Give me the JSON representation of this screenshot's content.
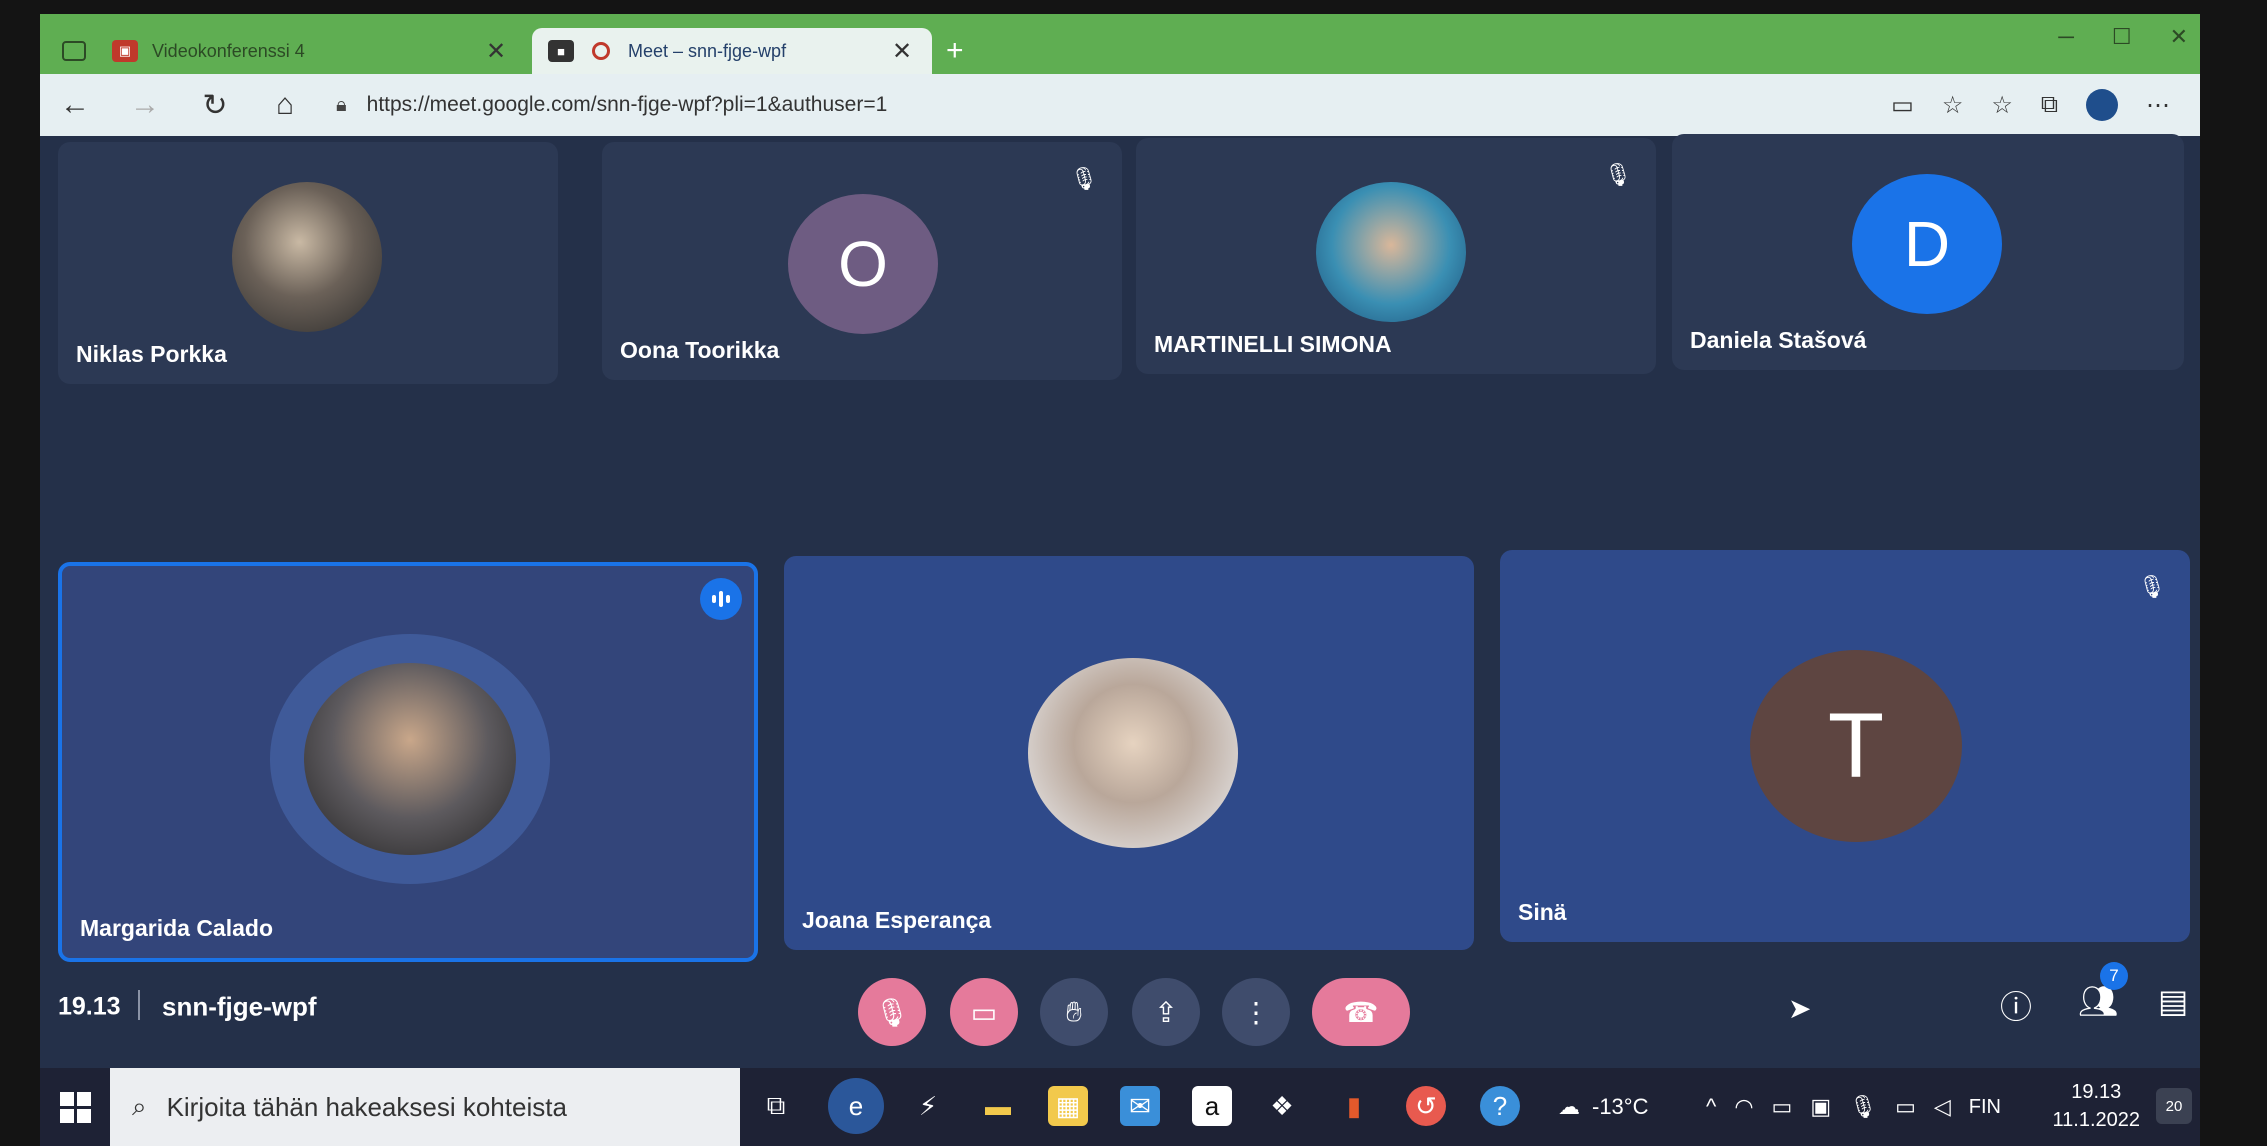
{
  "browser": {
    "tabs": [
      {
        "label": "Videokonferenssi 4",
        "icon": "classroom-icon",
        "active": false
      },
      {
        "label": "Meet – snn-fjge-wpf",
        "icon": "meet-icon",
        "active": true
      }
    ],
    "url": "https://meet.google.com/snn-fjge-wpf?pli=1&authuser=1",
    "tab_close_glyph": "✕",
    "new_tab_glyph": "+"
  },
  "participants_row1": [
    {
      "name": "Niklas Porkka",
      "initial": "",
      "muted": false
    },
    {
      "name": "Oona Toorikka",
      "initial": "O",
      "avatar_color": "#6e5c82",
      "muted": true
    },
    {
      "name": "MARTINELLI SIMONA",
      "initial": "",
      "muted": true
    },
    {
      "name": "Daniela Stašová",
      "initial": "D",
      "avatar_color": "#1a73e8",
      "muted": false
    }
  ],
  "participants_row2": [
    {
      "name": "Margarida Calado",
      "initial": "",
      "speaking": true,
      "muted": false
    },
    {
      "name": "Joana Esperança",
      "initial": "",
      "muted": false
    },
    {
      "name": "Sinä",
      "initial": "T",
      "avatar_color": "#5e4541",
      "muted": true
    }
  ],
  "meeting": {
    "time": "19.13",
    "code": "snn-fjge-wpf",
    "people_count": "7"
  },
  "taskbar": {
    "search_placeholder": "Kirjoita tähän hakeaksesi kohteista",
    "temperature": "-13°C",
    "language": "FIN",
    "time": "19.13",
    "date": "11.1.2022",
    "notifications": "20"
  },
  "colors": {
    "tab_bar": "#5fae52",
    "meet_bg": "#243049",
    "tile_bg": "#2c3954",
    "active_speaker": "#1a73e8",
    "control_red": "#e57a9b"
  }
}
